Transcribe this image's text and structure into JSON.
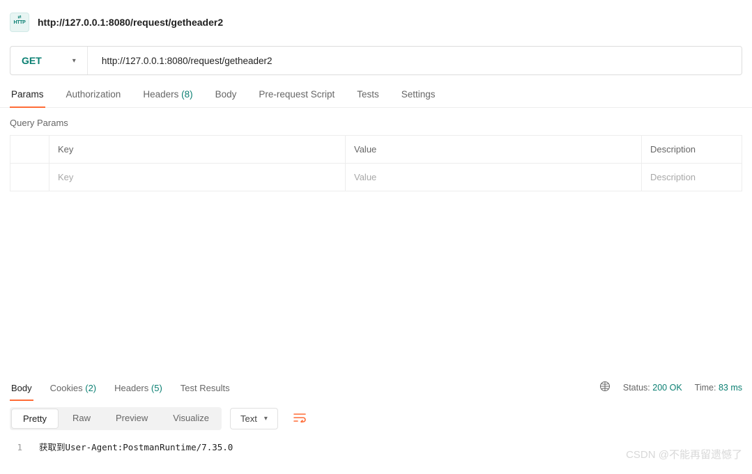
{
  "header": {
    "badge_label": "HTTP",
    "title": "http://127.0.0.1:8080/request/getheader2"
  },
  "request": {
    "method": "GET",
    "url": "http://127.0.0.1:8080/request/getheader2"
  },
  "tabs": [
    {
      "label": "Params",
      "count": null,
      "active": true
    },
    {
      "label": "Authorization",
      "count": null
    },
    {
      "label": "Headers",
      "count": "(8)"
    },
    {
      "label": "Body",
      "count": null
    },
    {
      "label": "Pre-request Script",
      "count": null
    },
    {
      "label": "Tests",
      "count": null
    },
    {
      "label": "Settings",
      "count": null
    }
  ],
  "params_section": {
    "title": "Query Params",
    "columns": {
      "key": "Key",
      "value": "Value",
      "description": "Description"
    },
    "placeholders": {
      "key": "Key",
      "value": "Value",
      "description": "Description"
    }
  },
  "response": {
    "tabs": [
      {
        "label": "Body",
        "count": null,
        "active": true
      },
      {
        "label": "Cookies",
        "count": "(2)"
      },
      {
        "label": "Headers",
        "count": "(5)"
      },
      {
        "label": "Test Results",
        "count": null
      }
    ],
    "status_label": "Status:",
    "status_value": "200 OK",
    "time_label": "Time:",
    "time_value": "83 ms",
    "view_tabs": [
      "Pretty",
      "Raw",
      "Preview",
      "Visualize"
    ],
    "format": "Text",
    "body_lines": [
      {
        "num": "1",
        "text": "获取到User-Agent:PostmanRuntime/7.35.0"
      }
    ]
  },
  "watermark": "CSDN @不能再留遗憾了"
}
